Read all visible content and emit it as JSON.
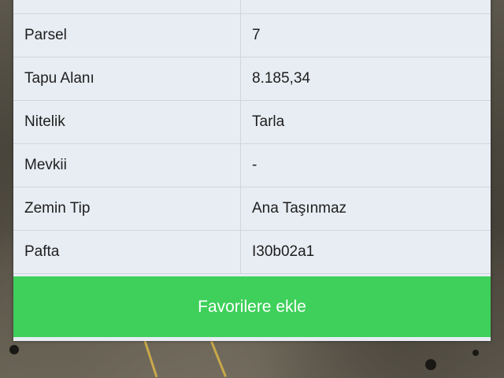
{
  "details": {
    "rows": [
      {
        "key": "",
        "value": ""
      },
      {
        "key": "Parsel",
        "value": "7"
      },
      {
        "key": "Tapu Alanı",
        "value": "8.185,34"
      },
      {
        "key": "Nitelik",
        "value": "Tarla"
      },
      {
        "key": "Mevkii",
        "value": "-"
      },
      {
        "key": "Zemin Tip",
        "value": "Ana Taşınmaz"
      },
      {
        "key": "Pafta",
        "value": "I30b02a1"
      }
    ]
  },
  "actions": {
    "favorite_label": "Favorilere ekle"
  },
  "colors": {
    "button_green": "#3ed05a",
    "card_bg": "#e8edf3"
  }
}
